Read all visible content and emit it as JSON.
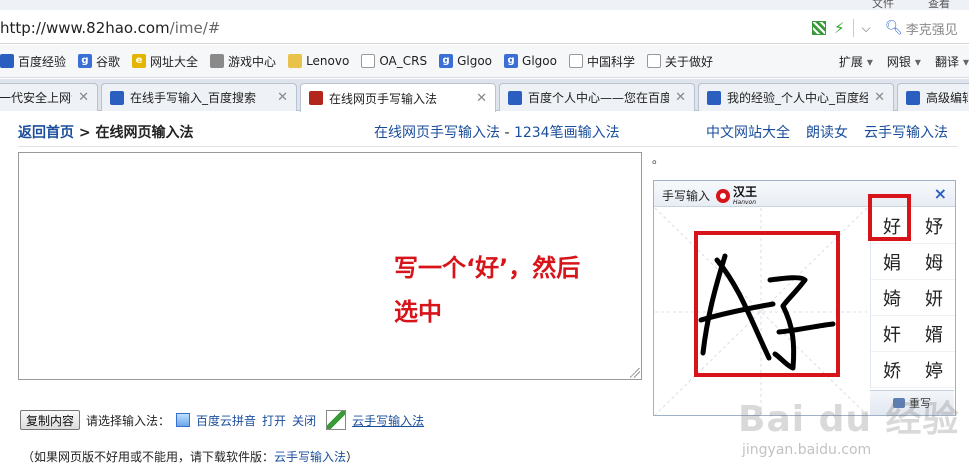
{
  "browser": {
    "top_menu": [
      "文件",
      "查看"
    ],
    "url_host": "http://www.82hao.com",
    "url_path": "/ime/#",
    "search_placeholder": "李克强见"
  },
  "bookmarks": [
    {
      "label": "百度经验",
      "icon": "paw-icon"
    },
    {
      "label": "谷歌",
      "icon": "google-icon"
    },
    {
      "label": "网址大全",
      "icon": "globe-icon"
    },
    {
      "label": "游戏中心",
      "icon": "gamepad-icon"
    },
    {
      "label": "Lenovo",
      "icon": "folder-icon"
    },
    {
      "label": "OA_CRS",
      "icon": "doc-icon"
    },
    {
      "label": "Glgoo",
      "icon": "google-icon"
    },
    {
      "label": "Glgoo",
      "icon": "google-icon"
    },
    {
      "label": "中国科学",
      "icon": "doc-icon"
    },
    {
      "label": "关于做好",
      "icon": "doc-icon"
    }
  ],
  "bookmarks_right": [
    {
      "label": "扩展",
      "icon": "grid-icon"
    },
    {
      "label": "网银",
      "icon": "shield-icon"
    },
    {
      "label": "翻译",
      "icon": "translate-icon"
    }
  ],
  "tabs": [
    {
      "label": "一代安全上网专",
      "active": false
    },
    {
      "label": "在线手写输入_百度搜索",
      "active": false
    },
    {
      "label": "在线网页手写输入法",
      "active": true
    },
    {
      "label": "百度个人中心——您在百度",
      "active": false
    },
    {
      "label": "我的经验_个人中心_百度经",
      "active": false
    },
    {
      "label": "高级编辑",
      "active": false
    }
  ],
  "page": {
    "back_home": "返回首页",
    "breadcrumb_sep": " > ",
    "breadcrumb_current": "在线网页输入法",
    "center_link1": "在线网页手写输入法",
    "center_sep": " - ",
    "center_link2": "1234笔画输入法",
    "right_links": [
      "中文网站大全",
      "朗读女",
      "云手写输入法"
    ],
    "dot": "。"
  },
  "annotation": {
    "line1": "写一个‘好’，然后",
    "line2": "选中"
  },
  "hw_panel": {
    "title": "手写输入",
    "logo_name": "汉王",
    "logo_sub": "Hanvon",
    "close": "×",
    "candidates": [
      "好",
      "妤",
      "娟",
      "姆",
      "婍",
      "妍",
      "奸",
      "婿",
      "娇",
      "婷"
    ],
    "rewrite": "重写"
  },
  "bottom": {
    "copy_button": "复制内容",
    "choose_label": "请选择输入法：",
    "pinyin_link": "百度云拼音",
    "open_link": "打开",
    "close_link": "关闭",
    "cloud_link": "云手写输入法",
    "note_prefix": "（如果网页版不好用或不能用，请下载软件版：",
    "note_link": "云手写输入法",
    "note_suffix": "）"
  },
  "watermark": {
    "big": "Bai du 经验",
    "small": "jingyan.baidu.com"
  },
  "colors": {
    "link": "#1a4e9c",
    "annotation_red": "#d8141b",
    "highlight_red": "#d8141b"
  }
}
